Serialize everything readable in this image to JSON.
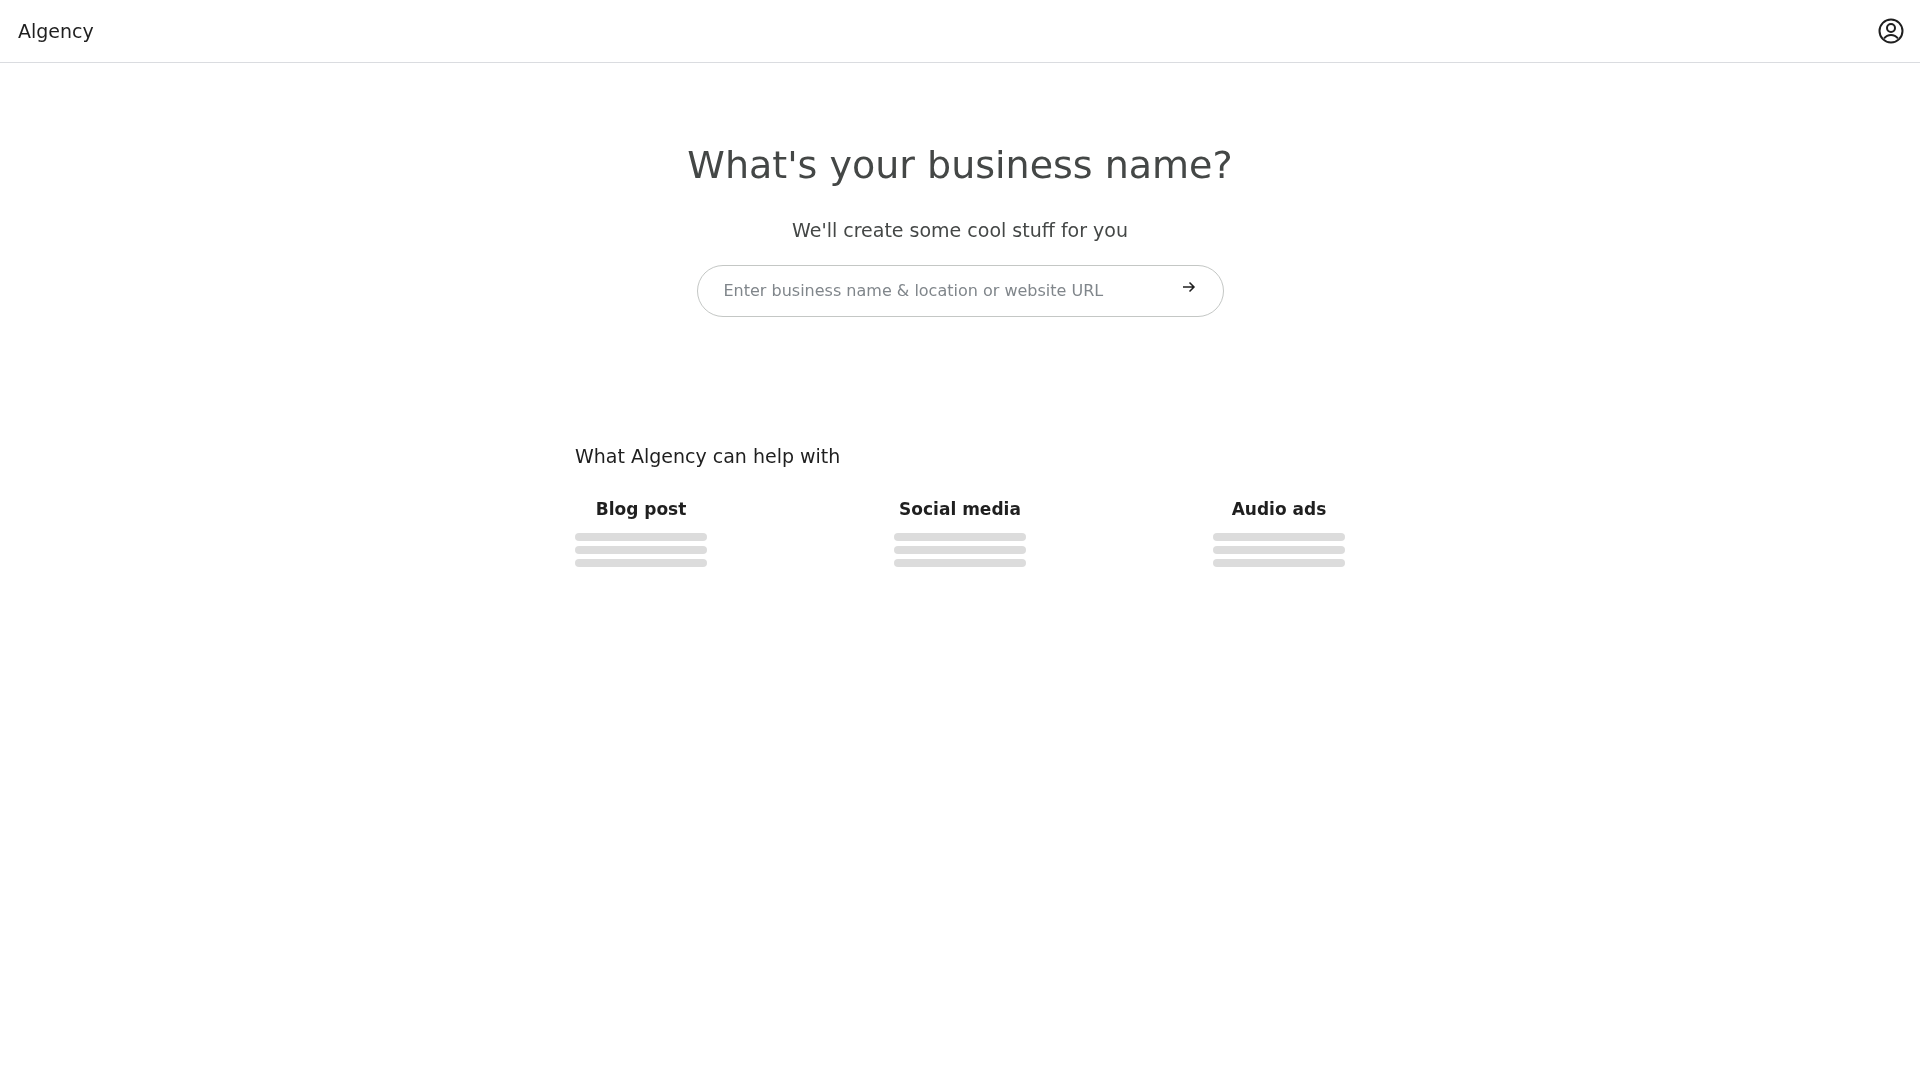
{
  "header": {
    "logo": "Algency"
  },
  "hero": {
    "title": "What's your business name?",
    "subtitle": "We'll create some cool stuff for you",
    "search": {
      "placeholder": "Enter business name & location or website URL"
    }
  },
  "help": {
    "heading": "What Algency can help with",
    "cards": [
      {
        "title": "Blog post",
        "loading": true
      },
      {
        "title": "Social media",
        "loading": true
      },
      {
        "title": "Audio ads",
        "loading": true
      }
    ]
  }
}
